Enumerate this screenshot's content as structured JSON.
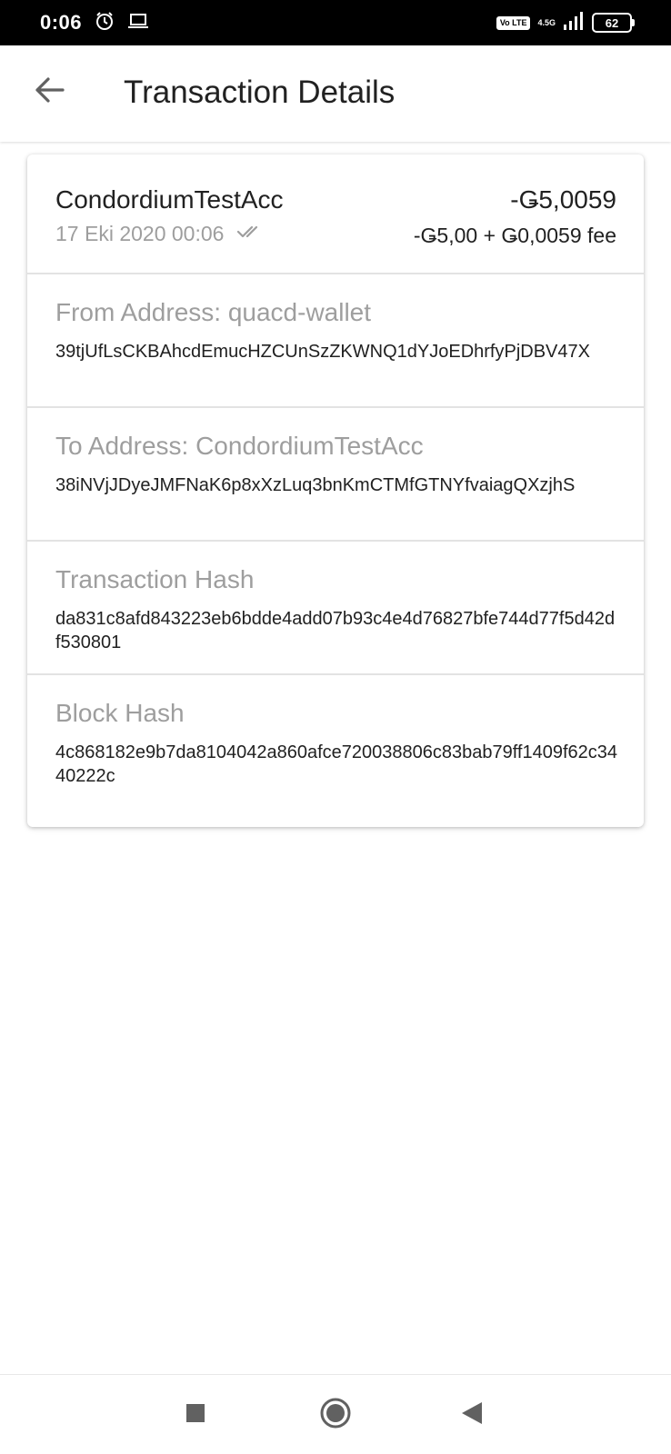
{
  "status_bar": {
    "time": "0:06",
    "alarm_icon": "alarm-icon",
    "laptop_icon": "laptop-icon",
    "volte": "Vo LTE",
    "network_type": "4.5G",
    "signal_icon": "signal-icon",
    "battery_level": "62"
  },
  "app_bar": {
    "back_icon": "back-arrow-icon",
    "title": "Transaction Details"
  },
  "transaction": {
    "account_name": "CondordiumTestAcc",
    "date": "17 Eki 2020 00:06",
    "status_icon": "double-check-icon",
    "amount": "-Ǥ5,0059",
    "amount_detail": "-Ǥ5,00 + Ǥ0,0059 fee"
  },
  "sections": [
    {
      "label": "From Address: quacd-wallet",
      "value": "39tjUfLsCKBAhcdEmucHZCUnSzZKWNQ1dYJoEDhrfyPjDBV47X"
    },
    {
      "label": "To Address: CondordiumTestAcc",
      "value": "38iNVjJDyeJMFNaK6p8xXzLuq3bnKmCTMfGTNYfvaiagQXzjhS"
    },
    {
      "label": "Transaction Hash",
      "value": "da831c8afd843223eb6bdde4add07b93c4e4d76827bfe744d77f5d42df530801"
    },
    {
      "label": "Block Hash",
      "value": "4c868182e9b7da8104042a860afce720038806c83bab79ff1409f62c3440222c"
    }
  ],
  "nav_bar": {
    "recents_icon": "square-recents-icon",
    "home_icon": "circle-home-icon",
    "back_icon": "triangle-back-icon"
  },
  "colors": {
    "status_bar_bg": "#000000",
    "text_primary": "#212121",
    "text_secondary": "#9e9e9e",
    "divider": "#e3e3e3",
    "icon_gray": "#616161"
  }
}
